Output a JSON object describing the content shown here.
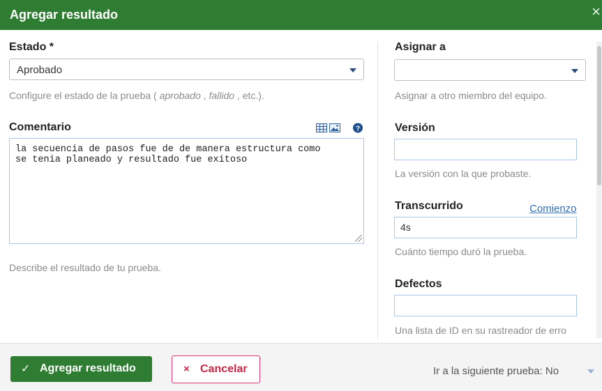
{
  "dialog": {
    "title": "Agregar resultado",
    "close_symbol": "×"
  },
  "left": {
    "estado": {
      "label": "Estado *",
      "value": "Aprobado",
      "help_prefix": "Configure el estado de la prueba ( ",
      "help_ex1": "aprobado",
      "help_sep": " , ",
      "help_ex2": "fallido",
      "help_suffix": " , etc.)."
    },
    "comentario": {
      "label": "Comentario",
      "text": "la secuencia de pasos fue de de manera estructura como\nse tenia planeado y resultado fue exitoso",
      "help": "Describe el resultado de tu prueba.",
      "icons": [
        "table-icon",
        "image-icon",
        "help-icon"
      ]
    }
  },
  "right": {
    "asignar": {
      "label": "Asignar a",
      "value": "",
      "help": "Asignar a otro miembro del equipo."
    },
    "version": {
      "label": "Versión",
      "value": "",
      "help": "La versión con la que probaste."
    },
    "transcurrido": {
      "label": "Transcurrido",
      "link": "Comienzo",
      "value": "4s",
      "help": "Cuánto tiempo duró la prueba."
    },
    "defectos": {
      "label": "Defectos",
      "value": "",
      "help": "Una lista de ID en su rastreador de erro"
    }
  },
  "footer": {
    "submit_icon": "✓",
    "submit_label": "Agregar resultado",
    "cancel_icon": "×",
    "cancel_label": "Cancelar",
    "next_label": "Ir a la siguiente prueba: No"
  },
  "colors": {
    "header": "#2e7d32",
    "primary_button": "#2e7d32",
    "cancel": "#c62846",
    "link": "#2f6fb8"
  }
}
